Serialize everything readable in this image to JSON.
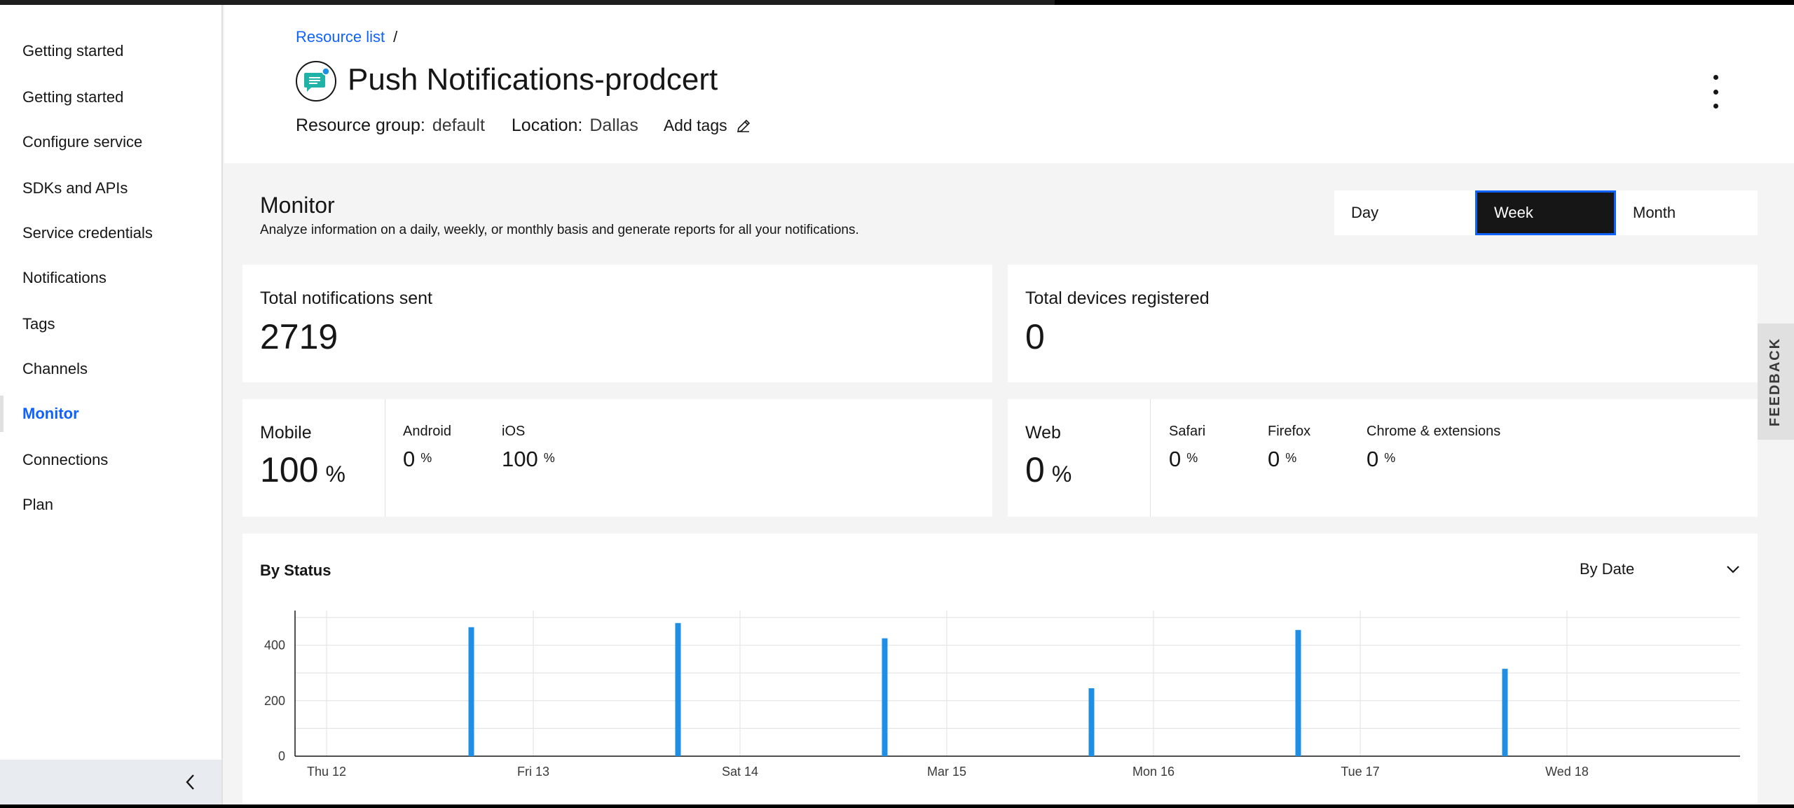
{
  "breadcrumb": {
    "link": "Resource list",
    "separator": "/"
  },
  "page_title": "Push Notifications-prodcert",
  "resource_group": {
    "label": "Resource group:",
    "value": "default"
  },
  "location": {
    "label": "Location:",
    "value": "Dallas"
  },
  "add_tags_label": "Add tags",
  "sidebar": {
    "items": [
      {
        "label": "Getting started"
      },
      {
        "label": "Getting started"
      },
      {
        "label": "Configure service"
      },
      {
        "label": "SDKs and APIs"
      },
      {
        "label": "Service credentials"
      },
      {
        "label": "Notifications"
      },
      {
        "label": "Tags"
      },
      {
        "label": "Channels"
      },
      {
        "label": "Monitor",
        "active": true
      },
      {
        "label": "Connections"
      },
      {
        "label": "Plan"
      }
    ]
  },
  "monitor": {
    "title": "Monitor",
    "description": "Analyze information on a daily, weekly, or monthly basis and generate reports for all your notifications.",
    "periods": [
      "Day",
      "Week",
      "Month"
    ],
    "selected_period": "Week"
  },
  "stats": {
    "total_sent": {
      "label": "Total notifications sent",
      "value": "2719"
    },
    "total_devices": {
      "label": "Total devices registered",
      "value": "0"
    },
    "mobile": {
      "label": "Mobile",
      "value": "100",
      "unit": "%",
      "android": {
        "label": "Android",
        "value": "0",
        "unit": "%"
      },
      "ios": {
        "label": "iOS",
        "value": "100",
        "unit": "%"
      }
    },
    "web": {
      "label": "Web",
      "value": "0",
      "unit": "%",
      "safari": {
        "label": "Safari",
        "value": "0",
        "unit": "%"
      },
      "firefox": {
        "label": "Firefox",
        "value": "0",
        "unit": "%"
      },
      "chrome": {
        "label": "Chrome & extensions",
        "value": "0",
        "unit": "%"
      }
    }
  },
  "status_chart": {
    "title": "By Status",
    "dropdown_label": "By Date"
  },
  "feedback_label": "FEEDBACK",
  "colors": {
    "accent": "#0f62fe",
    "bar": "#1f8fe5",
    "selected_bg": "#161616"
  },
  "chart_data": {
    "type": "bar",
    "categories": [
      "Thu 12",
      "Fri 13",
      "Sat 14",
      "Mar 15",
      "Mon 16",
      "Tue 17",
      "Wed 18"
    ],
    "x_tick_labels": [
      "Thu 12",
      "Fri 13",
      "Sat 14",
      "Mar 15",
      "Mon 16",
      "Tue 17",
      "Wed 18"
    ],
    "y_tick_labels": [
      "0",
      "200",
      "400"
    ],
    "values": [
      465,
      480,
      425,
      245,
      455,
      315
    ],
    "bar_dates": [
      "Thu 12",
      "Fri 13",
      "Sat 14",
      "Mar 15",
      "Mon 16",
      "Tue 17"
    ],
    "bar_day_offset": 0.7,
    "ylim": [
      0,
      525
    ],
    "grid": true
  }
}
